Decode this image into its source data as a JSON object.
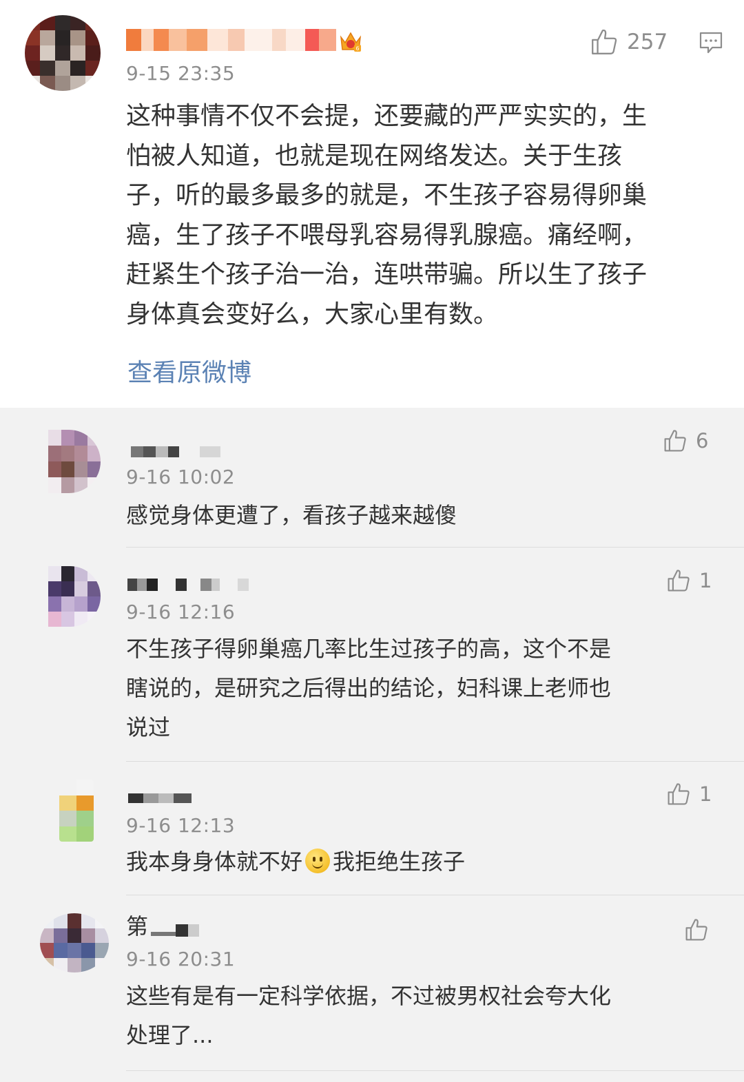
{
  "main_comment": {
    "time": "9-15 23:35",
    "likes": "257",
    "text_lines": [
      "这种事情不仅不会提，还要藏的严严实实的，生",
      "怕被人知道，也就是现在网络发达。关于生孩",
      "子，听的最多最多的就是，不生孩子容易得卵巢",
      "癌，生了孩子不喂母乳容易得乳腺癌。痛经啊，",
      "赶紧生个孩子治一治，连哄带骗。所以生了孩子",
      "身体真会变好么，大家心里有数。"
    ],
    "view_original": "查看原微博",
    "colors": {
      "link": "#5b82b4"
    },
    "icons": [
      "thumbs-up-icon",
      "comment-icon",
      "crown-badge-icon"
    ]
  },
  "replies": [
    {
      "name_prefix": "",
      "time": "9-16 10:02",
      "likes": "6",
      "text_lines": [
        "感觉身体更遭了，看孩子越来越傻"
      ]
    },
    {
      "name_prefix": "",
      "time": "9-16 12:16",
      "likes": "1",
      "text_lines": [
        "不生孩子得卵巢癌几率比生过孩子的高，这个不是",
        "瞎说的，是研究之后得出的结论，妇科课上老师也",
        "说过"
      ]
    },
    {
      "name_prefix": "",
      "time": "9-16 12:13",
      "likes": "1",
      "text_before_emoji": "我本身身体就不好",
      "emoji": "smile-emoji",
      "text_after_emoji": "我拒绝生孩子"
    },
    {
      "name_prefix": "第",
      "time": "9-16 20:31",
      "likes": "",
      "text_lines": [
        "这些有是有一定科学依据，不过被男权社会夸大化",
        "处理了..."
      ]
    }
  ]
}
